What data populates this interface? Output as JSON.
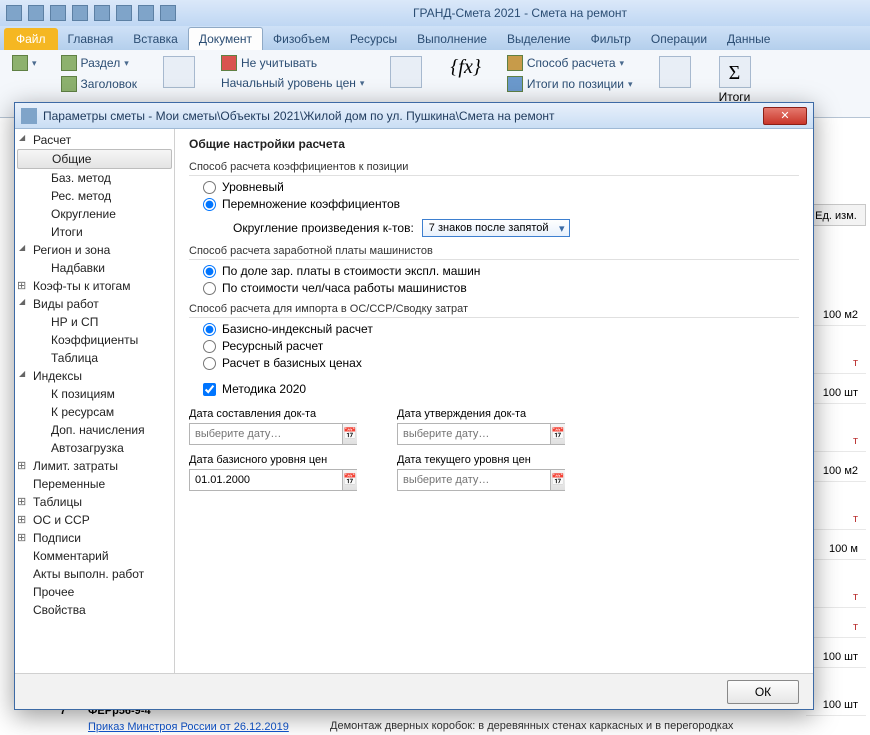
{
  "app_title": "ГРАНД-Смета 2021  -  Смета на ремонт",
  "file_tab": "Файл",
  "tabs": [
    "Главная",
    "Вставка",
    "Документ",
    "Физобъем",
    "Ресурсы",
    "Выполнение",
    "Выделение",
    "Фильтр",
    "Операции",
    "Данные"
  ],
  "active_tab": 2,
  "ribbon": {
    "razdel": "Раздел",
    "zagolovok": "Заголовок",
    "ne_uchit": "Не учитывать",
    "nach_uroven": "Начальный уровень цен",
    "sposob": "Способ расчета",
    "itogi_poz": "Итоги по позиции",
    "itogi": "Итоги"
  },
  "bg": {
    "hdr": "Ед. изм.",
    "rows": [
      {
        "v": "100 м2",
        "red": false
      },
      {
        "v": "т",
        "red": true
      },
      {
        "v": "100 шт",
        "red": false
      },
      {
        "v": "т",
        "red": true
      },
      {
        "v": "100 м2",
        "red": false
      },
      {
        "v": "т",
        "red": true
      },
      {
        "v": "100 м",
        "red": false
      },
      {
        "v": "т",
        "red": true
      },
      {
        "v": "т",
        "red": true
      },
      {
        "v": "100 шт",
        "red": false
      },
      {
        "v": "100 шт",
        "red": false
      }
    ],
    "fer_num": "7",
    "fer": "ФЕРр56-9-4",
    "prikaz": "Приказ Минстроя России от 26.12.2019",
    "desc": "Демонтаж дверных коробок: в деревянных стенах каркасных и в перегородках"
  },
  "dialog": {
    "title": "Параметры сметы - Мои сметы\\Объекты 2021\\Жилой дом по ул. Пушкина\\Смета на ремонт",
    "tree": [
      {
        "label": "Расчет",
        "lvl": 1,
        "cls": "exp"
      },
      {
        "label": "Общие",
        "lvl": 2,
        "cls": "sel"
      },
      {
        "label": "Баз. метод",
        "lvl": 2,
        "cls": ""
      },
      {
        "label": "Рес. метод",
        "lvl": 2,
        "cls": ""
      },
      {
        "label": "Округление",
        "lvl": 2,
        "cls": ""
      },
      {
        "label": "Итоги",
        "lvl": 2,
        "cls": ""
      },
      {
        "label": "Регион и зона",
        "lvl": 1,
        "cls": "exp"
      },
      {
        "label": "Надбавки",
        "lvl": 2,
        "cls": ""
      },
      {
        "label": "Коэф-ты к итогам",
        "lvl": 1,
        "cls": "plus"
      },
      {
        "label": "Виды работ",
        "lvl": 1,
        "cls": "exp"
      },
      {
        "label": "НР и СП",
        "lvl": 2,
        "cls": ""
      },
      {
        "label": "Коэффициенты",
        "lvl": 2,
        "cls": ""
      },
      {
        "label": "Таблица",
        "lvl": 2,
        "cls": ""
      },
      {
        "label": "Индексы",
        "lvl": 1,
        "cls": "exp"
      },
      {
        "label": "К позициям",
        "lvl": 2,
        "cls": ""
      },
      {
        "label": "К ресурсам",
        "lvl": 2,
        "cls": ""
      },
      {
        "label": "Доп. начисления",
        "lvl": 2,
        "cls": ""
      },
      {
        "label": "Автозагрузка",
        "lvl": 2,
        "cls": ""
      },
      {
        "label": "Лимит. затраты",
        "lvl": 1,
        "cls": "plus"
      },
      {
        "label": "Переменные",
        "lvl": 1,
        "cls": ""
      },
      {
        "label": "Таблицы",
        "lvl": 1,
        "cls": "plus"
      },
      {
        "label": "ОС и ССР",
        "lvl": 1,
        "cls": "plus"
      },
      {
        "label": "Подписи",
        "lvl": 1,
        "cls": "plus"
      },
      {
        "label": "Комментарий",
        "lvl": 1,
        "cls": ""
      },
      {
        "label": "Акты выполн. работ",
        "lvl": 1,
        "cls": ""
      },
      {
        "label": "Прочее",
        "lvl": 1,
        "cls": ""
      },
      {
        "label": "Свойства",
        "lvl": 1,
        "cls": ""
      }
    ],
    "heading": "Общие настройки расчета",
    "sec1": "Способ расчета коэффициентов к позиции",
    "r1a": "Уровневый",
    "r1b": "Перемножение коэффициентов",
    "okr_label": "Округление произведения к-тов:",
    "okr_value": "7 знаков после запятой",
    "sec2": "Способ расчета заработной платы машинистов",
    "r2a": "По доле зар. платы в стоимости экспл. машин",
    "r2b": "По стоимости чел/часа работы машинистов",
    "sec3": "Способ расчета для импорта в ОС/ССР/Сводку затрат",
    "r3a": "Базисно-индексный расчет",
    "r3b": "Ресурсный расчет",
    "r3c": "Расчет в базисных ценах",
    "chk1": "Методика 2020",
    "d1": "Дата составления док-та",
    "d2": "Дата утверждения док-та",
    "d3": "Дата базисного уровня цен",
    "d4": "Дата текущего уровня цен",
    "placeholder": "выберите дату…",
    "d3_val": "01.01.2000",
    "ok": "ОК"
  }
}
